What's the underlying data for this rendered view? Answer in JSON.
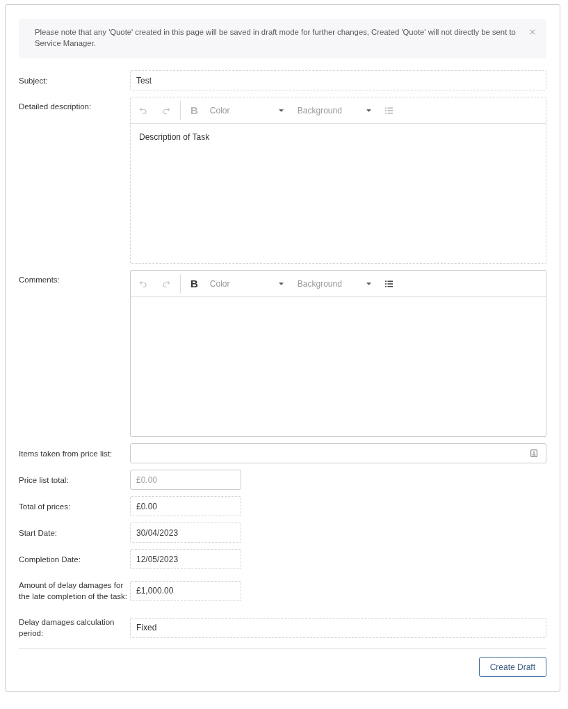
{
  "notice": {
    "text": "Please note that any 'Quote' created in this page will be saved in draft mode for further changes, Created 'Quote' will not directly be sent to Service Manager.",
    "dismissible": true
  },
  "fields": [
    {
      "kind": "text",
      "label": "Subject:",
      "value": "Test",
      "readonly": true
    },
    {
      "kind": "editor",
      "label": "Detailed description:",
      "readonly": true,
      "toolbar": {
        "bold_label": "B",
        "text_color_label": "Color",
        "background_label": "Background"
      },
      "value": "Description of Task"
    },
    {
      "kind": "editor",
      "label": "Comments:",
      "readonly": false,
      "toolbar": {
        "bold_label": "B",
        "text_color_label": "Color",
        "background_label": "Background"
      }
    },
    {
      "kind": "lookup",
      "label": "Items taken from price list:",
      "readonly": false
    },
    {
      "kind": "money",
      "label": "Price list total:",
      "placeholder": "£0.00",
      "readonly": false
    },
    {
      "kind": "money",
      "label": "Total of prices:",
      "value": "£0.00",
      "readonly": true
    },
    {
      "kind": "date",
      "label": "Start Date:",
      "value": "30/04/2023",
      "readonly": true
    },
    {
      "kind": "date",
      "label": "Completion Date:",
      "value": "12/05/2023",
      "readonly": true
    },
    {
      "kind": "money",
      "label": "Amount of delay damages for the late completion of the task:",
      "value": "£1,000.00",
      "readonly": true
    },
    {
      "kind": "select",
      "label": "Delay damages calculation period:",
      "value": "Fixed",
      "readonly": true
    }
  ],
  "actions": [
    {
      "label": "Create Draft"
    }
  ]
}
